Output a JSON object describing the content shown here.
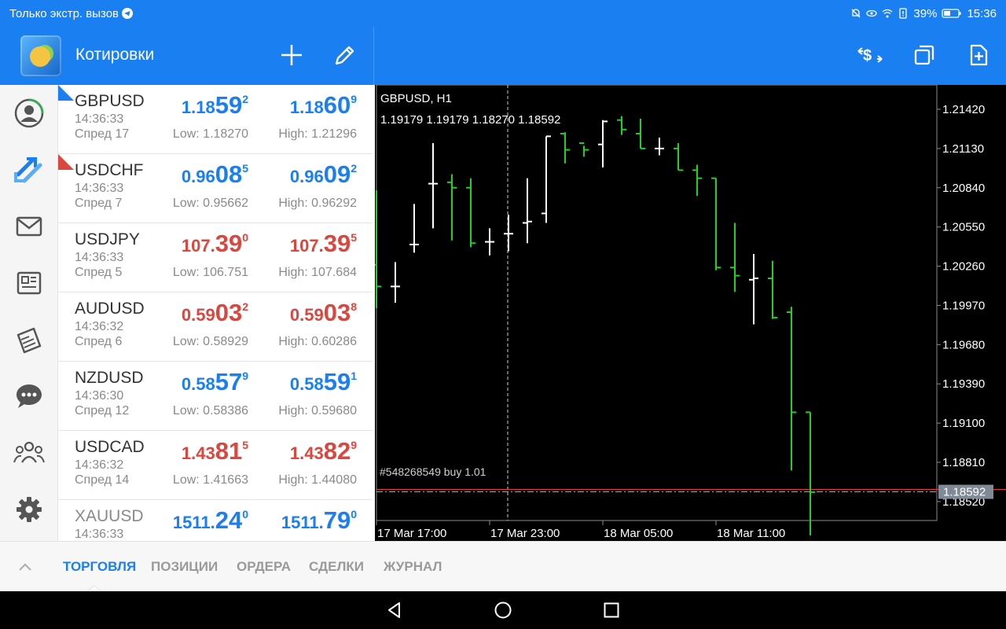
{
  "status_bar": {
    "left_text": "Только экстр. вызов",
    "battery": "39%",
    "time": "15:36"
  },
  "app_bar": {
    "title": "Котировки",
    "icons": [
      "plus-icon",
      "pencil-icon",
      "exchange-icon",
      "windows-icon",
      "add-document-icon"
    ]
  },
  "nav": {
    "items": [
      "account-icon",
      "trade-arrows-icon",
      "mail-icon",
      "news-icon",
      "calendar-icon",
      "chat-icon",
      "community-icon",
      "settings-icon"
    ]
  },
  "colors": {
    "accent": "#1a7ff0",
    "up": "#1a7ff0",
    "down": "#d9473f",
    "bull": "#22d022",
    "bear": "#ffffff"
  },
  "quotes": [
    {
      "symbol": "GBPUSD",
      "time": "14:36:33",
      "spread": "Спред 17",
      "bid": {
        "pre": "1.18",
        "big": "59",
        "sup": "2"
      },
      "ask": {
        "pre": "1.18",
        "big": "60",
        "sup": "9"
      },
      "low": "Low: 1.18270",
      "high": "High: 1.21296",
      "direction": "up"
    },
    {
      "symbol": "USDCHF",
      "time": "14:36:33",
      "spread": "Спред 7",
      "bid": {
        "pre": "0.96",
        "big": "08",
        "sup": "5"
      },
      "ask": {
        "pre": "0.96",
        "big": "09",
        "sup": "2"
      },
      "low": "Low: 0.95662",
      "high": "High: 0.96292",
      "direction": "up"
    },
    {
      "symbol": "USDJPY",
      "time": "14:36:33",
      "spread": "Спред 5",
      "bid": {
        "pre": "107.",
        "big": "39",
        "sup": "0"
      },
      "ask": {
        "pre": "107.",
        "big": "39",
        "sup": "5"
      },
      "low": "Low: 106.751",
      "high": "High: 107.684",
      "direction": "down"
    },
    {
      "symbol": "AUDUSD",
      "time": "14:36:32",
      "spread": "Спред 6",
      "bid": {
        "pre": "0.59",
        "big": "03",
        "sup": "2"
      },
      "ask": {
        "pre": "0.59",
        "big": "03",
        "sup": "8"
      },
      "low": "Low: 0.58929",
      "high": "High: 0.60286",
      "direction": "down"
    },
    {
      "symbol": "NZDUSD",
      "time": "14:36:30",
      "spread": "Спред 12",
      "bid": {
        "pre": "0.58",
        "big": "57",
        "sup": "9"
      },
      "ask": {
        "pre": "0.58",
        "big": "59",
        "sup": "1"
      },
      "low": "Low: 0.58386",
      "high": "High: 0.59680",
      "direction": "up"
    },
    {
      "symbol": "USDCAD",
      "time": "14:36:32",
      "spread": "Спред 14",
      "bid": {
        "pre": "1.43",
        "big": "81",
        "sup": "5"
      },
      "ask": {
        "pre": "1.43",
        "big": "82",
        "sup": "9"
      },
      "low": "Low: 1.41663",
      "high": "High: 1.44080",
      "direction": "down"
    },
    {
      "symbol": "XAUUSD",
      "time": "14:36:33",
      "spread": "",
      "bid": {
        "pre": "1511.",
        "big": "24",
        "sup": "0"
      },
      "ask": {
        "pre": "1511.",
        "big": "79",
        "sup": "0"
      },
      "low": "",
      "high": "",
      "direction": "up"
    }
  ],
  "chart": {
    "title": "GBPUSD, H1",
    "ohlc": "1.19179 1.19179 1.18270 1.18592",
    "order_label": "#548268549 buy 1.01",
    "current_price": "1.18592"
  },
  "chart_data": {
    "type": "ohlc",
    "title": "GBPUSD, H1",
    "y_ticks": [
      "1.21420",
      "1.21130",
      "1.20840",
      "1.20550",
      "1.20260",
      "1.19970",
      "1.19680",
      "1.19390",
      "1.19100",
      "1.18810",
      "1.18520"
    ],
    "x_ticks": [
      "17 Mar 17:00",
      "17 Mar 23:00",
      "18 Mar 05:00",
      "18 Mar 11:00"
    ],
    "ylim": [
      1.1838,
      1.216
    ],
    "current_price": 1.18592,
    "order_price": 1.1861,
    "bars": [
      {
        "o": 1.2027,
        "h": 1.2082,
        "l": 1.1995,
        "c": 1.2011
      },
      {
        "o": 1.2011,
        "h": 1.2029,
        "l": 1.1999,
        "c": 1.2011
      },
      {
        "o": 1.2042,
        "h": 1.2072,
        "l": 1.2036,
        "c": 1.2042
      },
      {
        "o": 1.2087,
        "h": 1.2117,
        "l": 1.2054,
        "c": 1.2087
      },
      {
        "o": 1.2088,
        "h": 1.2094,
        "l": 1.2045,
        "c": 1.2084
      },
      {
        "o": 1.2084,
        "h": 1.2091,
        "l": 1.204,
        "c": 1.2043
      },
      {
        "o": 1.2044,
        "h": 1.2054,
        "l": 1.2034,
        "c": 1.2044
      },
      {
        "o": 1.205,
        "h": 1.2064,
        "l": 1.2037,
        "c": 1.205
      },
      {
        "o": 1.2058,
        "h": 1.2091,
        "l": 1.2043,
        "c": 1.2059
      },
      {
        "o": 1.2065,
        "h": 1.2122,
        "l": 1.2058,
        "c": 1.2122
      },
      {
        "o": 1.2124,
        "h": 1.2125,
        "l": 1.2102,
        "c": 1.2112
      },
      {
        "o": 1.2117,
        "h": 1.2115,
        "l": 1.2107,
        "c": 1.2112
      },
      {
        "o": 1.2116,
        "h": 1.2134,
        "l": 1.2099,
        "c": 1.2133
      },
      {
        "o": 1.2134,
        "h": 1.2137,
        "l": 1.2123,
        "c": 1.2127
      },
      {
        "o": 1.2124,
        "h": 1.2135,
        "l": 1.2113,
        "c": 1.2113
      },
      {
        "o": 1.2113,
        "h": 1.2121,
        "l": 1.2108,
        "c": 1.2113
      },
      {
        "o": 1.2113,
        "h": 1.2117,
        "l": 1.2097,
        "c": 1.2097
      },
      {
        "o": 1.2097,
        "h": 1.2101,
        "l": 1.2078,
        "c": 1.2091
      },
      {
        "o": 1.2091,
        "h": 1.2091,
        "l": 1.2023,
        "c": 1.2025
      },
      {
        "o": 1.2025,
        "h": 1.2058,
        "l": 1.2007,
        "c": 1.2019
      },
      {
        "o": 1.2016,
        "h": 1.2035,
        "l": 1.1983,
        "c": 1.2017
      },
      {
        "o": 1.2017,
        "h": 1.203,
        "l": 1.1987,
        "c": 1.1988
      },
      {
        "o": 1.1992,
        "h": 1.1996,
        "l": 1.1875,
        "c": 1.1918
      },
      {
        "o": 1.1918,
        "h": 1.1918,
        "l": 1.1827,
        "c": 1.1859
      }
    ]
  },
  "tabs": {
    "active": "ТОРГОВЛЯ",
    "items": [
      "ТОРГОВЛЯ",
      "ПОЗИЦИИ",
      "ОРДЕРА",
      "СДЕЛКИ",
      "ЖУРНАЛ"
    ]
  },
  "system_nav": [
    "back-icon",
    "home-icon",
    "recents-icon"
  ]
}
